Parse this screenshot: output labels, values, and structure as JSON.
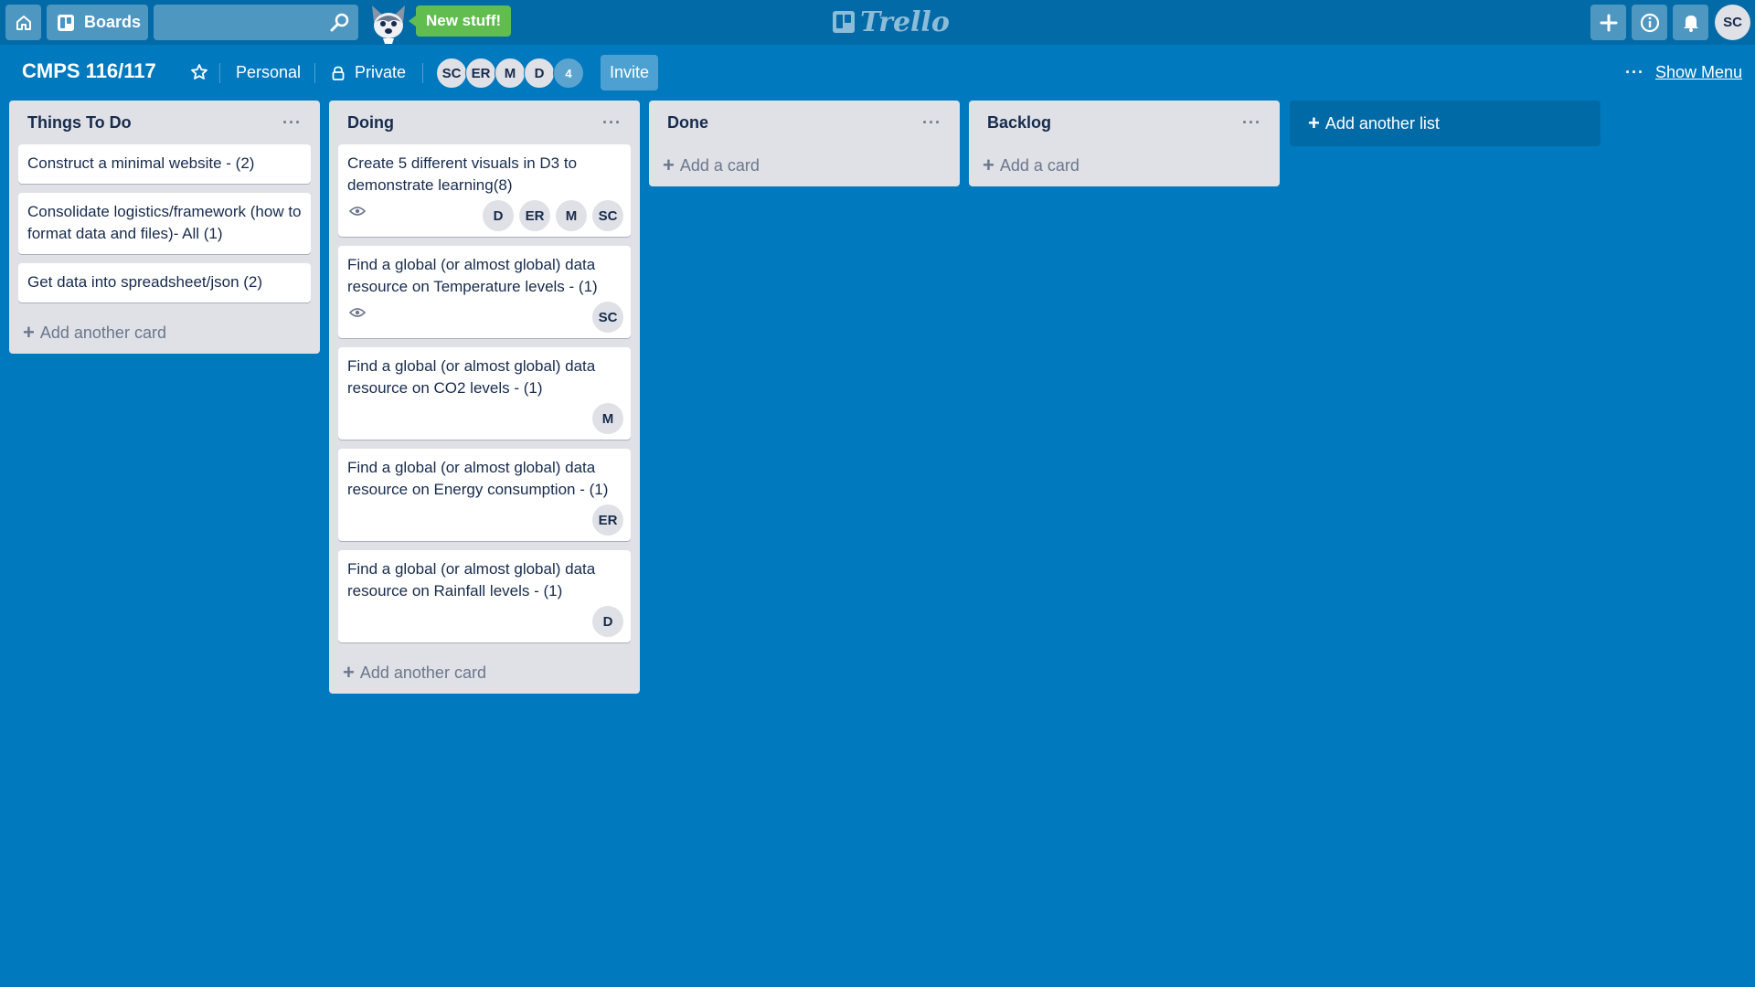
{
  "header": {
    "boards_label": "Boards",
    "search_value": "",
    "new_stuff_label": "New stuff!",
    "logo_text": "Trello",
    "user_initials": "SC"
  },
  "board": {
    "title": "CMPS 116/117",
    "team_label": "Personal",
    "visibility_label": "Private",
    "members": [
      "SC",
      "ER",
      "M",
      "D"
    ],
    "extra_members_count": "4",
    "invite_label": "Invite",
    "show_menu_label": "Show Menu",
    "add_list_label": "Add another list"
  },
  "lists": [
    {
      "title": "Things To Do",
      "add_label": "Add another card",
      "cards": [
        {
          "text": "Construct a minimal website - (2)"
        },
        {
          "text": "Consolidate logistics/framework (how to format data and files)- All (1)"
        },
        {
          "text": "Get data into spreadsheet/json (2)"
        }
      ]
    },
    {
      "title": "Doing",
      "add_label": "Add another card",
      "cards": [
        {
          "text": "Create 5 different visuals in D3 to demonstrate learning(8)",
          "members": [
            "D",
            "ER",
            "M",
            "SC"
          ]
        },
        {
          "text": "Find a global (or almost global) data resource on Temperature levels - (1)",
          "members": [
            "SC"
          ]
        },
        {
          "text": "Find a global (or almost global) data resource on CO2 levels - (1)",
          "members": [
            "M"
          ]
        },
        {
          "text": "Find a global (or almost global) data resource on Energy consumption - (1)",
          "members": [
            "ER"
          ]
        },
        {
          "text": "Find a global (or almost global) data resource on Rainfall levels - (1)",
          "members": [
            "D"
          ]
        }
      ]
    },
    {
      "title": "Done",
      "add_label": "Add a card",
      "cards": []
    },
    {
      "title": "Backlog",
      "add_label": "Add a card",
      "cards": []
    }
  ],
  "colors": {
    "board_bg": "#0079bf",
    "header_bg": "#026aa7",
    "list_bg": "#dfe1e6",
    "new_stuff_bg": "#61bd4f"
  }
}
